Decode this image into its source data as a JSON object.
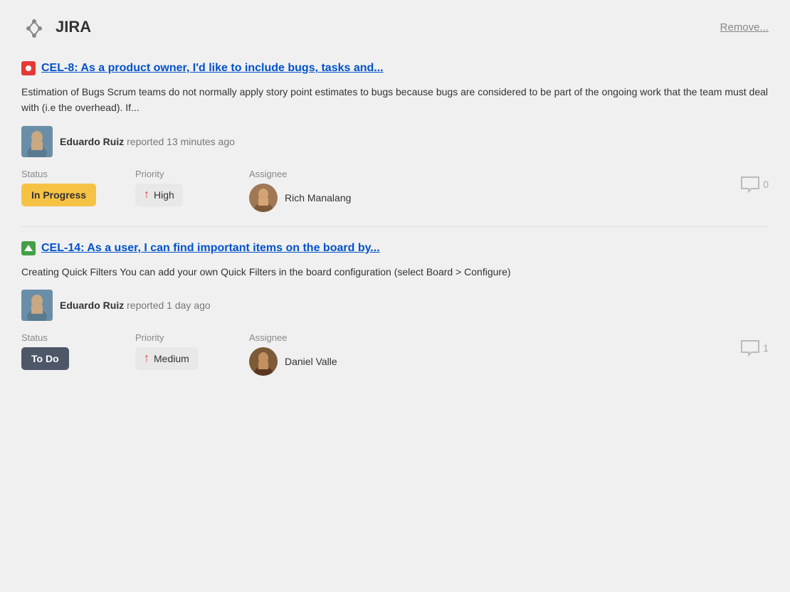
{
  "app": {
    "title": "JIRA",
    "remove_label": "Remove..."
  },
  "issues": [
    {
      "id": "issue-cel8",
      "icon_type": "bug",
      "title": "CEL-8: As a product owner, I'd like to include bugs, tasks and...",
      "description": "Estimation of Bugs Scrum teams do not normally apply story point estimates to bugs because bugs are considered to be part of the ongoing work that the team must deal with (i.e the overhead). If...",
      "reporter_name": "Eduardo Ruiz",
      "reported_time": "reported 13 minutes ago",
      "status_label": "Status",
      "status_value": "In Progress",
      "status_type": "inprogress",
      "priority_label": "Priority",
      "priority_value": "High",
      "assignee_label": "Assignee",
      "assignee_name": "Rich Manalang",
      "comment_count": "0"
    },
    {
      "id": "issue-cel14",
      "icon_type": "story",
      "title": "CEL-14: As a user, I can find important items on the board by...",
      "description": "Creating Quick Filters You can add your own Quick Filters in the board configuration (select Board > Configure)",
      "reporter_name": "Eduardo Ruiz",
      "reported_time": "reported 1 day ago",
      "status_label": "Status",
      "status_value": "To Do",
      "status_type": "todo",
      "priority_label": "Priority",
      "priority_value": "Medium",
      "assignee_label": "Assignee",
      "assignee_name": "Daniel Valle",
      "comment_count": "1"
    }
  ]
}
